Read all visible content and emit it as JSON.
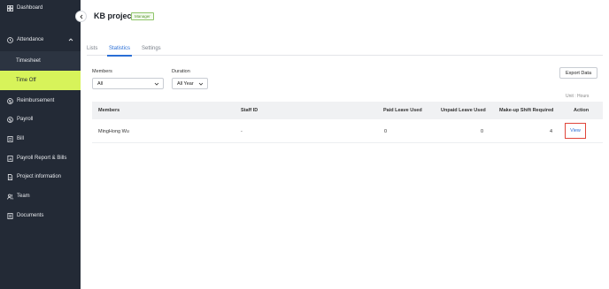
{
  "sidebar": {
    "items": [
      {
        "label": "Dashboard",
        "icon": "grid-icon"
      },
      {
        "label": "Attendance",
        "icon": "clock-icon"
      },
      {
        "label": "Timesheet"
      },
      {
        "label": "Time Off"
      },
      {
        "label": "Reimbursement",
        "icon": "dollar-circle-icon"
      },
      {
        "label": "Payroll",
        "icon": "dollar-circle-icon"
      },
      {
        "label": "Bill",
        "icon": "receipt-icon"
      },
      {
        "label": "Payroll Report & Bills",
        "icon": "report-icon"
      },
      {
        "label": "Project information",
        "icon": "file-icon"
      },
      {
        "label": "Team",
        "icon": "team-icon"
      },
      {
        "label": "Documents",
        "icon": "document-icon"
      }
    ],
    "active_item": "Time Off",
    "accent_color": "#d7f35a"
  },
  "header": {
    "title": "KB project",
    "badge": "Manager"
  },
  "tabs": [
    {
      "label": "Lists"
    },
    {
      "label": "Statistics"
    },
    {
      "label": "Settings"
    }
  ],
  "active_tab": "Statistics",
  "filters": {
    "members_label": "Members",
    "members_value": "All",
    "duration_label": "Duration",
    "duration_value": "All Year"
  },
  "export_label": "Export Data",
  "unit_text": "Unit : Hours",
  "table": {
    "headers": [
      "Members",
      "Staff ID",
      "Paid Leave Used",
      "Unpaid Leave Used",
      "Make-up Shift Required",
      "Action"
    ],
    "rows": [
      {
        "member": "MingHong Wu",
        "staff_id": "-",
        "paid": "0",
        "unpaid": "0",
        "makeup": "4",
        "action": "View"
      }
    ]
  }
}
